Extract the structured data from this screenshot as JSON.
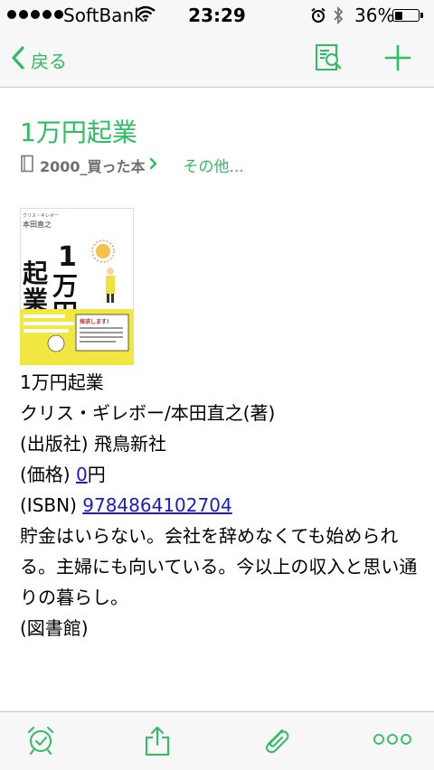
{
  "status_bar": {
    "carrier": "SoftBank",
    "time": "23:29",
    "battery_percent": "36%",
    "battery_level": 0.36,
    "signal_dots": 5
  },
  "nav": {
    "back_label": "戻る",
    "icons": [
      "note-search-icon",
      "plus-icon"
    ]
  },
  "note": {
    "title": "1万円起業",
    "notebook": "2000_買った本",
    "more_label": "その他...",
    "cover": {
      "author_line": "クリス・ギレボー",
      "translator": "本田直之",
      "big_chars": [
        "1",
        "万",
        "円",
        "起",
        "業"
      ],
      "banner": "探求します!"
    },
    "lines": {
      "book_title": "1万円起業",
      "author": "クリス・ギレボー/本田直之(著)",
      "publisher_label": "(出版社)",
      "publisher": "飛鳥新社",
      "price_label": "(価格)",
      "price_value": "0",
      "price_unit": "円",
      "isbn_label": "(ISBN)",
      "isbn": "9784864102704",
      "description": "貯金はいらない。会社を辞めなくても始められる。主婦にも向いている。今以上の収入と思い通りの暮らし。",
      "library": "(図書館)"
    }
  },
  "toolbar": {
    "icons": [
      "alarm-clock-icon",
      "share-icon",
      "paperclip-icon",
      "more-icon"
    ]
  },
  "colors": {
    "accent": "#2dbe60",
    "link": "#1a1ad0",
    "bar_bg": "#f7f7f7"
  }
}
